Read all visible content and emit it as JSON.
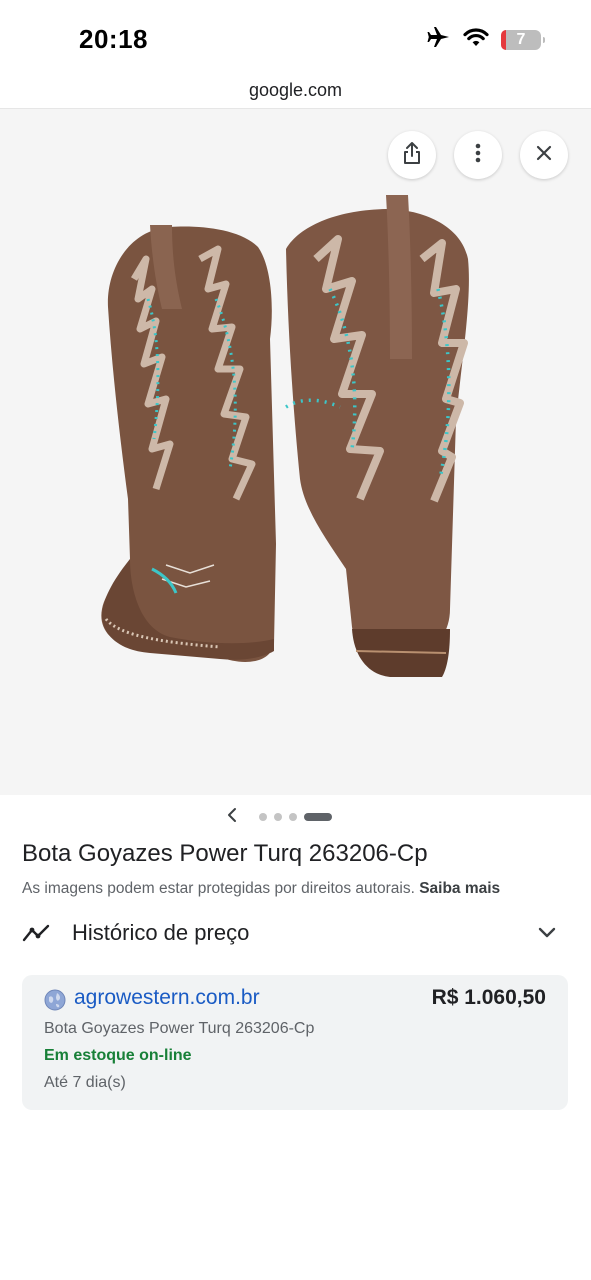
{
  "status_bar": {
    "time": "20:18",
    "battery_level": "7",
    "icons": [
      "airplane-icon",
      "wifi-icon",
      "battery-icon"
    ]
  },
  "browser": {
    "url": "google.com"
  },
  "image_viewer": {
    "buttons": [
      "share-icon",
      "more-icon",
      "close-icon"
    ],
    "carousel": {
      "total": 4,
      "active_index": 3
    }
  },
  "product": {
    "title": "Bota Goyazes Power Turq 263206-Cp",
    "copyright_notice": "As imagens podem estar protegidas por direitos autorais.",
    "learn_more": "Saiba mais"
  },
  "price_history": {
    "label": "Histórico de preço"
  },
  "offer": {
    "merchant": "agrowestern.com.br",
    "price": "R$ 1.060,50",
    "product_name": "Bota Goyazes Power Turq 263206-Cp",
    "stock": "Em estoque on-line",
    "delivery": "Até 7 dia(s)"
  },
  "colors": {
    "link": "#1a5bc4",
    "in_stock": "#188038",
    "boot_leather": "#7a5440",
    "embroidery_turquoise": "#3cc6c8"
  }
}
